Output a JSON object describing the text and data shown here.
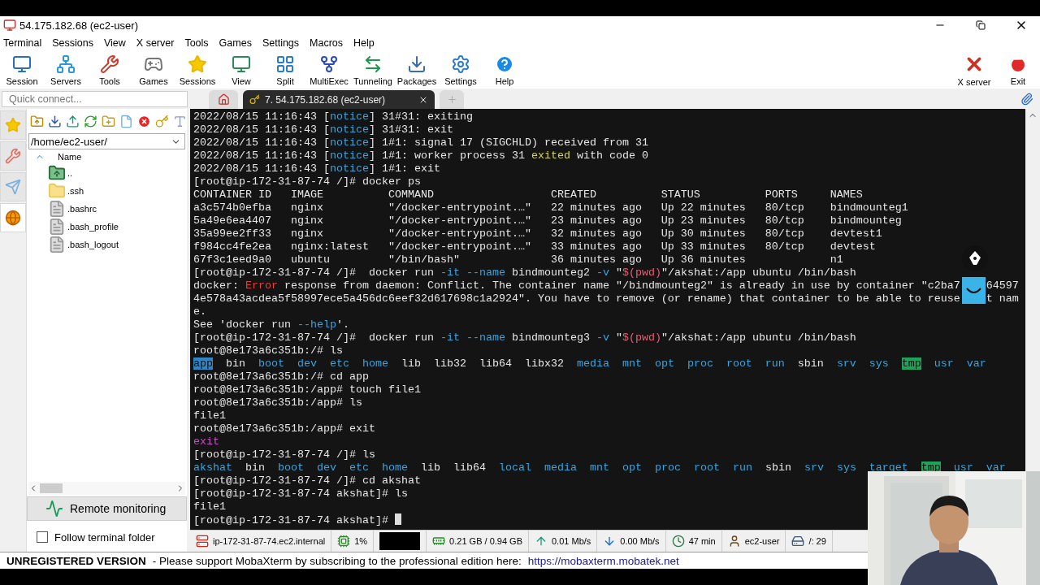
{
  "window": {
    "title": "54.175.182.68 (ec2-user)"
  },
  "menu": [
    "Terminal",
    "Sessions",
    "View",
    "X server",
    "Tools",
    "Games",
    "Settings",
    "Macros",
    "Help"
  ],
  "toolbar": [
    {
      "kind": "session",
      "label": "Session"
    },
    {
      "kind": "servers",
      "label": "Servers"
    },
    {
      "kind": "tools",
      "label": "Tools"
    },
    {
      "kind": "games",
      "label": "Games"
    },
    {
      "kind": "sessions",
      "label": "Sessions"
    },
    {
      "kind": "view",
      "label": "View"
    },
    {
      "kind": "split",
      "label": "Split"
    },
    {
      "kind": "multiexec",
      "label": "MultiExec"
    },
    {
      "kind": "tunneling",
      "label": "Tunneling"
    },
    {
      "kind": "packages",
      "label": "Packages"
    },
    {
      "kind": "settings",
      "label": "Settings"
    },
    {
      "kind": "help",
      "label": "Help"
    }
  ],
  "toolbar_right": [
    {
      "kind": "xserver",
      "label": "X server"
    },
    {
      "kind": "exit",
      "label": "Exit"
    }
  ],
  "quick_connect": {
    "placeholder": "Quick connect..."
  },
  "tabs": [
    {
      "kind": "home",
      "selected": false
    },
    {
      "kind": "session",
      "label": "7. 54.175.182.68 (ec2-user)",
      "selected": true
    },
    {
      "kind": "new",
      "selected": false
    }
  ],
  "side_tabs": [
    {
      "kind": "star",
      "selected": false
    },
    {
      "kind": "tools",
      "selected": false
    },
    {
      "kind": "send",
      "selected": false
    },
    {
      "kind": "sftp",
      "selected": true
    }
  ],
  "sidebar": {
    "path": "/home/ec2-user/",
    "column": "Name",
    "files": [
      {
        "name": "..",
        "kind": "up"
      },
      {
        "name": ".ssh",
        "kind": "folder"
      },
      {
        "name": ".bashrc",
        "kind": "file"
      },
      {
        "name": ".bash_profile",
        "kind": "file"
      },
      {
        "name": ".bash_logout",
        "kind": "file"
      }
    ],
    "remote_monitoring": "Remote monitoring",
    "follow": {
      "label": "Follow terminal folder",
      "checked": false
    }
  },
  "terminal": {
    "cursor": true,
    "lines": [
      [
        {
          "t": "2022/08/15 11:16:43 [",
          "kind": "plain"
        },
        {
          "t": "notice",
          "kind": "info"
        },
        {
          "t": "] 31#31: exiting",
          "kind": "plain"
        }
      ],
      [
        {
          "t": "2022/08/15 11:16:43 [",
          "kind": "plain"
        },
        {
          "t": "notice",
          "kind": "info"
        },
        {
          "t": "] 31#31: exit",
          "kind": "plain"
        }
      ],
      [
        {
          "t": "2022/08/15 11:16:43 [",
          "kind": "plain"
        },
        {
          "t": "notice",
          "kind": "info"
        },
        {
          "t": "] 1#1: signal 17 (SIGCHLD) received from 31",
          "kind": "plain"
        }
      ],
      [
        {
          "t": "2022/08/15 11:16:43 [",
          "kind": "plain"
        },
        {
          "t": "notice",
          "kind": "info"
        },
        {
          "t": "] 1#1: worker process 31 ",
          "kind": "plain"
        },
        {
          "t": "exited",
          "kind": "warn"
        },
        {
          "t": " with code 0",
          "kind": "plain"
        }
      ],
      [
        {
          "t": "2022/08/15 11:16:43 [",
          "kind": "plain"
        },
        {
          "t": "notice",
          "kind": "info"
        },
        {
          "t": "] 1#1: exit",
          "kind": "plain"
        }
      ],
      [
        {
          "t": "[root@ip-172-31-87-74 /]# docker ps",
          "kind": "plain"
        }
      ],
      [
        {
          "t": "CONTAINER ID   IMAGE          COMMAND                  CREATED          STATUS          PORTS     NAMES",
          "kind": "plain"
        }
      ],
      [
        {
          "t": "a3c574b0efba   nginx          \"/docker-entrypoint.…\"   22 minutes ago   Up 22 minutes   80/tcp    bindmounteg1",
          "kind": "plain"
        }
      ],
      [
        {
          "t": "5a49e6ea4407   nginx          \"/docker-entrypoint.…\"   23 minutes ago   Up 23 minutes   80/tcp    bindmounteg",
          "kind": "plain"
        }
      ],
      [
        {
          "t": "35a99ee2ff33   nginx          \"/docker-entrypoint.…\"   32 minutes ago   Up 30 minutes   80/tcp    devtest1",
          "kind": "plain"
        }
      ],
      [
        {
          "t": "f984cc4fe2ea   nginx:latest   \"/docker-entrypoint.…\"   33 minutes ago   Up 33 minutes   80/tcp    devtest",
          "kind": "plain"
        }
      ],
      [
        {
          "t": "67f3c1eed9a0   ubuntu         \"/bin/bash\"              36 minutes ago   Up 36 minutes             n1",
          "kind": "plain"
        }
      ],
      [
        {
          "t": "[root@ip-172-31-87-74 /]#  docker run ",
          "kind": "plain"
        },
        {
          "t": "-it --name",
          "kind": "info"
        },
        {
          "t": " bindmounteg2 ",
          "kind": "plain"
        },
        {
          "t": "-v",
          "kind": "info"
        },
        {
          "t": " \"",
          "kind": "plain"
        },
        {
          "t": "$(pwd)",
          "kind": "var"
        },
        {
          "t": "\"/akshat:/app ubuntu /bin/bash",
          "kind": "plain"
        }
      ],
      [
        {
          "t": "docker: ",
          "kind": "plain"
        },
        {
          "t": "Error",
          "kind": "error"
        },
        {
          "t": " response from daemon: Conflict. The container name \"/bindmounteg2\" is already in use by container \"c2ba7    64597",
          "kind": "plain"
        }
      ],
      [
        {
          "t": "4e578a43acdea5f58997ece5a456dc6eef32d617698c1a2924\". You have to remove (or rename) that container to be able to reuse    t nam",
          "kind": "plain"
        }
      ],
      [
        {
          "t": "e.",
          "kind": "plain"
        }
      ],
      [
        {
          "t": "See 'docker run ",
          "kind": "plain"
        },
        {
          "t": "--help",
          "kind": "info"
        },
        {
          "t": "'.",
          "kind": "plain"
        }
      ],
      [
        {
          "t": "[root@ip-172-31-87-74 /]#  docker run ",
          "kind": "plain"
        },
        {
          "t": "-it --name",
          "kind": "info"
        },
        {
          "t": " bindmounteg3 ",
          "kind": "plain"
        },
        {
          "t": "-v",
          "kind": "info"
        },
        {
          "t": " \"",
          "kind": "plain"
        },
        {
          "t": "$(pwd)",
          "kind": "var"
        },
        {
          "t": "\"/akshat:/app ubuntu /bin/bash",
          "kind": "plain"
        }
      ],
      [
        {
          "t": "root@8e173a6c351b:/# ls",
          "kind": "plain"
        }
      ],
      [
        {
          "t": "app",
          "kind": "sel"
        },
        {
          "t": "  bin  ",
          "kind": "plain"
        },
        {
          "t": "boot  dev  etc  home",
          "kind": "info"
        },
        {
          "t": "  lib  lib32  lib64  libx32  ",
          "kind": "plain"
        },
        {
          "t": "media  mnt  opt  proc  root  run",
          "kind": "info"
        },
        {
          "t": "  sbin  ",
          "kind": "plain"
        },
        {
          "t": "srv  sys  ",
          "kind": "info"
        },
        {
          "t": "tmp",
          "kind": "tmp"
        },
        {
          "t": "  usr  var",
          "kind": "info"
        }
      ],
      [
        {
          "t": "root@8e173a6c351b:/# cd app",
          "kind": "plain"
        }
      ],
      [
        {
          "t": "root@8e173a6c351b:/app# touch file1",
          "kind": "plain"
        }
      ],
      [
        {
          "t": "root@8e173a6c351b:/app# ls",
          "kind": "plain"
        }
      ],
      [
        {
          "t": "file1",
          "kind": "plain"
        }
      ],
      [
        {
          "t": "root@8e173a6c351b:/app# exit",
          "kind": "plain"
        }
      ],
      [
        {
          "t": "exit",
          "kind": "exit"
        }
      ],
      [
        {
          "t": "[root@ip-172-31-87-74 /]# ls",
          "kind": "plain"
        }
      ],
      [
        {
          "t": "akshat",
          "kind": "info"
        },
        {
          "t": "  bin  ",
          "kind": "plain"
        },
        {
          "t": "boot  dev  etc  home",
          "kind": "info"
        },
        {
          "t": "  lib  lib64  ",
          "kind": "plain"
        },
        {
          "t": "local  media  mnt  opt  proc  root  run",
          "kind": "info"
        },
        {
          "t": "  sbin  ",
          "kind": "plain"
        },
        {
          "t": "srv  sys  target  ",
          "kind": "info"
        },
        {
          "t": "tmp",
          "kind": "tmp"
        },
        {
          "t": "  usr  var",
          "kind": "info"
        }
      ],
      [
        {
          "t": "[root@ip-172-31-87-74 /]# cd akshat",
          "kind": "plain"
        }
      ],
      [
        {
          "t": "[root@ip-172-31-87-74 akshat]# ls",
          "kind": "plain"
        }
      ],
      [
        {
          "t": "file1",
          "kind": "plain"
        }
      ],
      [
        {
          "t": "[root@ip-172-31-87-74 akshat]# ",
          "kind": "plain"
        }
      ]
    ]
  },
  "status_bar": [
    {
      "kind": "host",
      "text": "ip-172-31-87-74.ec2.internal"
    },
    {
      "kind": "cpu",
      "text": "1%"
    },
    {
      "kind": "graph"
    },
    {
      "kind": "memory",
      "text": "0.21 GB / 0.94 GB"
    },
    {
      "kind": "upload",
      "text": "0.01 Mb/s"
    },
    {
      "kind": "download",
      "text": "0.00 Mb/s"
    },
    {
      "kind": "uptime",
      "text": "47 min"
    },
    {
      "kind": "user",
      "text": "ec2-user"
    },
    {
      "kind": "disk",
      "text": "/: 29"
    }
  ],
  "footer": {
    "label": "UNREGISTERED VERSION",
    "message": "-  Please support MobaXterm by subscribing to the professional edition here:",
    "link": "https://mobaxterm.mobatek.net"
  }
}
